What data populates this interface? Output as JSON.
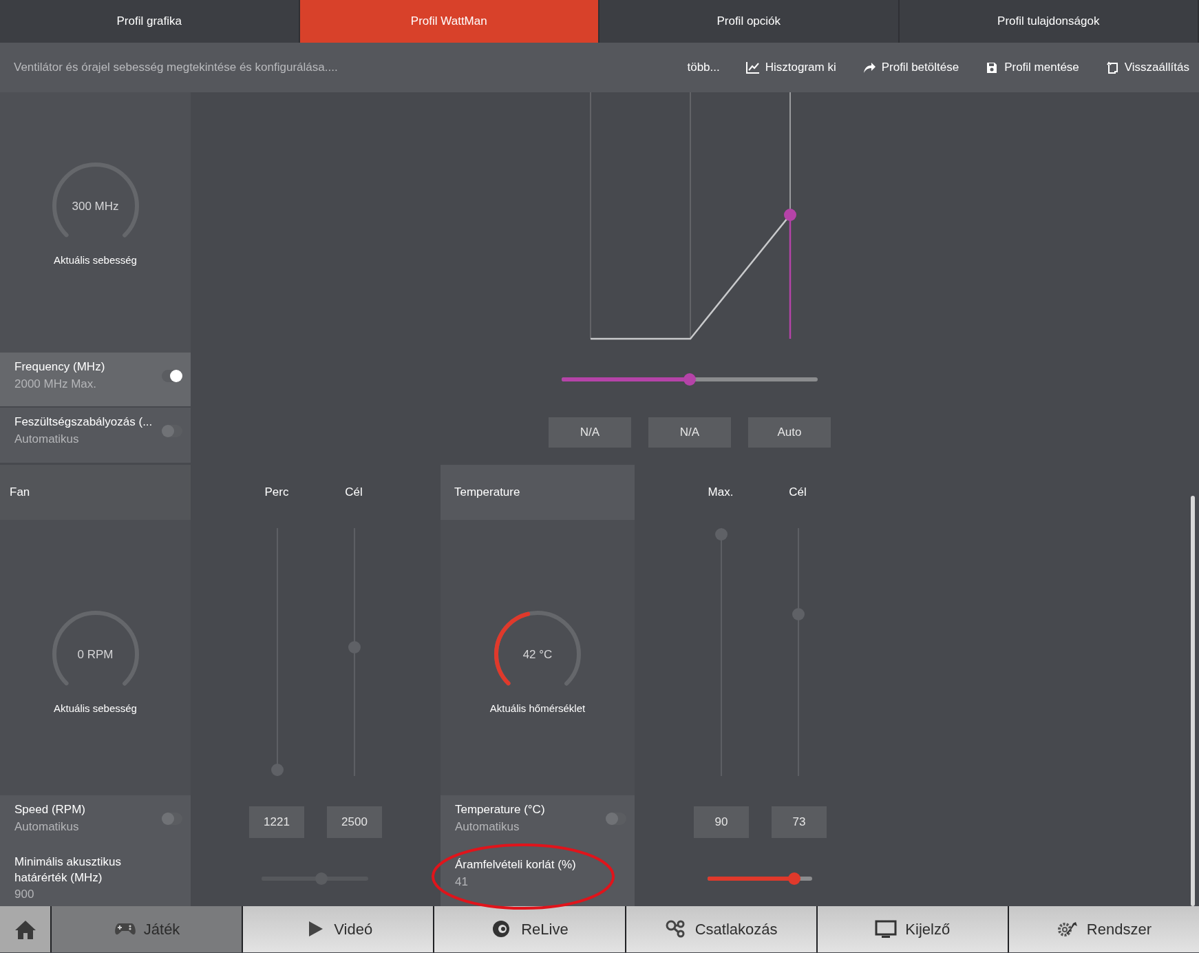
{
  "tabs": [
    {
      "label": "Profil grafika",
      "selected": false
    },
    {
      "label": "Profil WattMan",
      "selected": true
    },
    {
      "label": "Profil opciók",
      "selected": false
    },
    {
      "label": "Profil tulajdonságok",
      "selected": false
    }
  ],
  "toolbar": {
    "description": "Ventilátor és órajel sebesség megtekintése és konfigurálása....",
    "actions": [
      {
        "label": "több..."
      },
      {
        "label": "Hisztogram ki"
      },
      {
        "label": "Profil betöltése"
      },
      {
        "label": "Profil mentése"
      },
      {
        "label": "Visszaállítás"
      }
    ]
  },
  "clock": {
    "gauge": {
      "reading": "300 MHz",
      "label": "Aktuális sebesség"
    },
    "frequency": {
      "label": "Frequency (MHz)",
      "value": "2000 MHz Max.",
      "on": true,
      "slider": {
        "level": 0.5
      }
    },
    "voltage": {
      "label": "Feszültségszabályozás (...",
      "value": "Automatikus",
      "on": false,
      "states": [
        "N/A",
        "N/A",
        "Auto"
      ]
    }
  },
  "fan": {
    "title": "Fan",
    "columns": [
      "Perc",
      "Cél"
    ],
    "sliders": [
      {
        "level": 0
      },
      {
        "level": 0.52
      }
    ],
    "gauge": {
      "reading": "0 RPM",
      "label": "Aktuális sebesség"
    },
    "speed": {
      "label": "Speed (RPM)",
      "value": "Automatikus",
      "on": false,
      "inputs": [
        "1221",
        "2500"
      ]
    },
    "acoustic": {
      "label": "Minimális akusztikus határérték (MHz)",
      "value": "900",
      "disabled": true,
      "slider": {
        "level": 0.57
      }
    }
  },
  "temperature": {
    "title": "Temperature",
    "columns": [
      "Max.",
      "Cél"
    ],
    "sliders": [
      {
        "level": 1
      },
      {
        "level": 0.66
      }
    ],
    "gauge": {
      "reading": "42 °C",
      "label": "Aktuális hőmérséklet",
      "level": 0.45
    },
    "setting": {
      "label": "Temperature (°C)",
      "value": "Automatikus",
      "on": false,
      "inputs": [
        "90",
        "73"
      ]
    },
    "power_limit": {
      "label": "Áramfelvételi korlát (%)",
      "value": "41",
      "slider": {
        "level": 0.87
      }
    }
  },
  "nav": {
    "items": [
      {
        "label": "Játék",
        "selected": true
      },
      {
        "label": "Videó",
        "selected": false
      },
      {
        "label": "ReLive",
        "selected": false
      },
      {
        "label": "Csatlakozás",
        "selected": false
      },
      {
        "label": "Kijelző",
        "selected": false
      },
      {
        "label": "Rendszer",
        "selected": false
      }
    ]
  }
}
